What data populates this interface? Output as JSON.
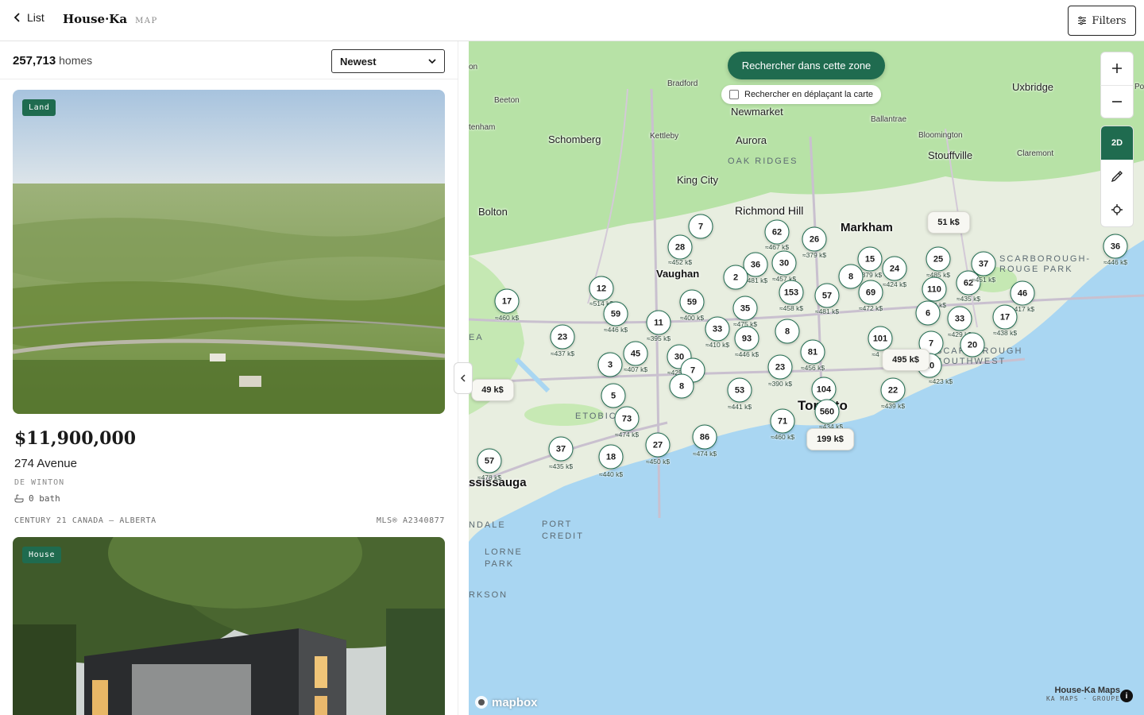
{
  "header": {
    "back_label": "List",
    "brand": "House·Ka",
    "brand_sub": "MAP",
    "filters_label": "Filters"
  },
  "list": {
    "count": "257,713",
    "count_suffix": " homes",
    "sort_value": "Newest",
    "cards": [
      {
        "badge": "Land",
        "price": "$11,900,000",
        "address": "274 Avenue",
        "city": "DE WINTON",
        "baths": "0 bath",
        "broker": "CENTURY 21 CANADA — ALBERTA",
        "mls": "MLS® A2340877"
      },
      {
        "badge": "House"
      }
    ]
  },
  "map": {
    "search_zone_label": "Rechercher dans cette zone",
    "search_move_label": "Rechercher en déplaçant la carte",
    "mode_label": "2D",
    "attribution_main": "House-Ka Maps",
    "attribution_sub": "KA MAPS · GROUPE",
    "mapbox_label": "mapbox",
    "places": [
      {
        "label": "Bradford"
      },
      {
        "label": "Beeton"
      },
      {
        "label": "Newmarket"
      },
      {
        "label": "Schomberg"
      },
      {
        "label": "Kettleby"
      },
      {
        "label": "Aurora"
      },
      {
        "label": "OAK RIDGES"
      },
      {
        "label": "King City"
      },
      {
        "label": "Ballantrae"
      },
      {
        "label": "Bloomington"
      },
      {
        "label": "Stouffville"
      },
      {
        "label": "Uxbridge"
      },
      {
        "label": "Claremont"
      },
      {
        "label": "Bolton"
      },
      {
        "label": "Richmond Hill"
      },
      {
        "label": "Markham"
      },
      {
        "label": "Vaughan"
      },
      {
        "label": "SCARBOROUGH-ROUGE PARK"
      },
      {
        "label": "SCARBOROUGH SOUTHWEST"
      },
      {
        "label": "ETOBICOKE"
      },
      {
        "label": "Toronto"
      },
      {
        "label": "ssissauga"
      },
      {
        "label": "PORT CREDIT"
      },
      {
        "label": "NDALE"
      },
      {
        "label": "LORNE PARK"
      },
      {
        "label": "RKSON"
      },
      {
        "label": "tenham"
      },
      {
        "label": "on"
      },
      {
        "label": "EA"
      },
      {
        "label": "Po"
      }
    ],
    "clusters": [
      {
        "count": "7"
      },
      {
        "count": "28",
        "price": "≈452 k$"
      },
      {
        "count": "62",
        "price": "≈467 k$"
      },
      {
        "count": "26",
        "price": "≈379 k$"
      },
      {
        "count": "36",
        "price": "≈481 k$"
      },
      {
        "count": "30",
        "price": "≈457 k$"
      },
      {
        "count": "2"
      },
      {
        "count": "12",
        "price": "≈514 k$"
      },
      {
        "count": "17",
        "price": "≈460 k$"
      },
      {
        "count": "59",
        "price": "≈446 k$"
      },
      {
        "count": "59",
        "price": "≈400 k$"
      },
      {
        "count": "11",
        "price": "≈395 k$"
      },
      {
        "count": "35",
        "price": "≈475 k$"
      },
      {
        "count": "153",
        "price": "≈458 k$"
      },
      {
        "count": "57",
        "price": "≈481 k$"
      },
      {
        "count": "15",
        "price": "≈379 k$"
      },
      {
        "count": "8"
      },
      {
        "count": "69",
        "price": "≈472 k$"
      },
      {
        "count": "24",
        "price": "≈424 k$"
      },
      {
        "count": "25",
        "price": "≈485 k$"
      },
      {
        "count": "110",
        "price": "≈434 k$"
      },
      {
        "count": "62",
        "price": "≈435 k$"
      },
      {
        "count": "37",
        "price": "≈451 k$"
      },
      {
        "count": "46",
        "price": "≈417 k$"
      },
      {
        "count": "36",
        "price": "≈446 k$"
      },
      {
        "count": "6"
      },
      {
        "count": "33",
        "price": "≈429 k$"
      },
      {
        "count": "17",
        "price": "≈438 k$"
      },
      {
        "count": "33",
        "price": "≈410 k$"
      },
      {
        "count": "93",
        "price": "≈446 k$"
      },
      {
        "count": "8"
      },
      {
        "count": "23",
        "price": "≈437 k$"
      },
      {
        "count": "45",
        "price": "≈407 k$"
      },
      {
        "count": "3"
      },
      {
        "count": "30",
        "price": "≈425 k$"
      },
      {
        "count": "7"
      },
      {
        "count": "8"
      },
      {
        "count": "23",
        "price": "≈390 k$"
      },
      {
        "count": "81",
        "price": "≈456 k$"
      },
      {
        "count": "101",
        "price": "≈4"
      },
      {
        "count": "7"
      },
      {
        "count": "20"
      },
      {
        "count": "10",
        "price": "≈423 k$"
      },
      {
        "count": "5"
      },
      {
        "count": "53",
        "price": "≈441 k$"
      },
      {
        "count": "104"
      },
      {
        "count": "22",
        "price": "≈439 k$"
      },
      {
        "count": "73",
        "price": "≈474 k$"
      },
      {
        "count": "71",
        "price": "≈460 k$"
      },
      {
        "count": "560",
        "price": "≈434 k$"
      },
      {
        "count": "86",
        "price": "≈474 k$"
      },
      {
        "count": "27",
        "price": "≈450 k$"
      },
      {
        "count": "37",
        "price": "≈435 k$"
      },
      {
        "count": "18",
        "price": "≈440 k$"
      },
      {
        "count": "57",
        "price": "≈478 k$"
      }
    ],
    "price_tags": [
      {
        "label": "51 k$"
      },
      {
        "label": "495 k$"
      },
      {
        "label": "49 k$"
      },
      {
        "label": "199 k$"
      }
    ],
    "colors": {
      "accent": "#1f6b4f",
      "water": "#a9d6f2",
      "land": "#e8eee0",
      "green": "#b7e2a6"
    }
  }
}
